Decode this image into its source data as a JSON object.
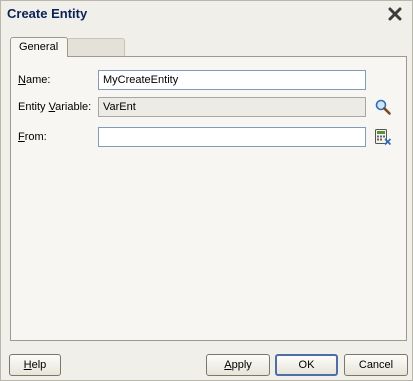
{
  "dialog": {
    "title": "Create Entity"
  },
  "tabs": [
    {
      "label": "General"
    },
    {
      "label": ""
    }
  ],
  "form": {
    "name_label_first": "N",
    "name_label_rest": "ame:",
    "name_value": "MyCreateEntity",
    "entity_label_pre": "Entity ",
    "entity_label_mnemonic": "V",
    "entity_label_post": "ariable:",
    "entity_value": "VarEnt",
    "from_label_first": "F",
    "from_label_rest": "rom:",
    "from_value": ""
  },
  "buttons": {
    "help_first": "H",
    "help_rest": "elp",
    "apply_first": "A",
    "apply_rest": "pply",
    "ok": "OK",
    "cancel": "Cancel"
  }
}
